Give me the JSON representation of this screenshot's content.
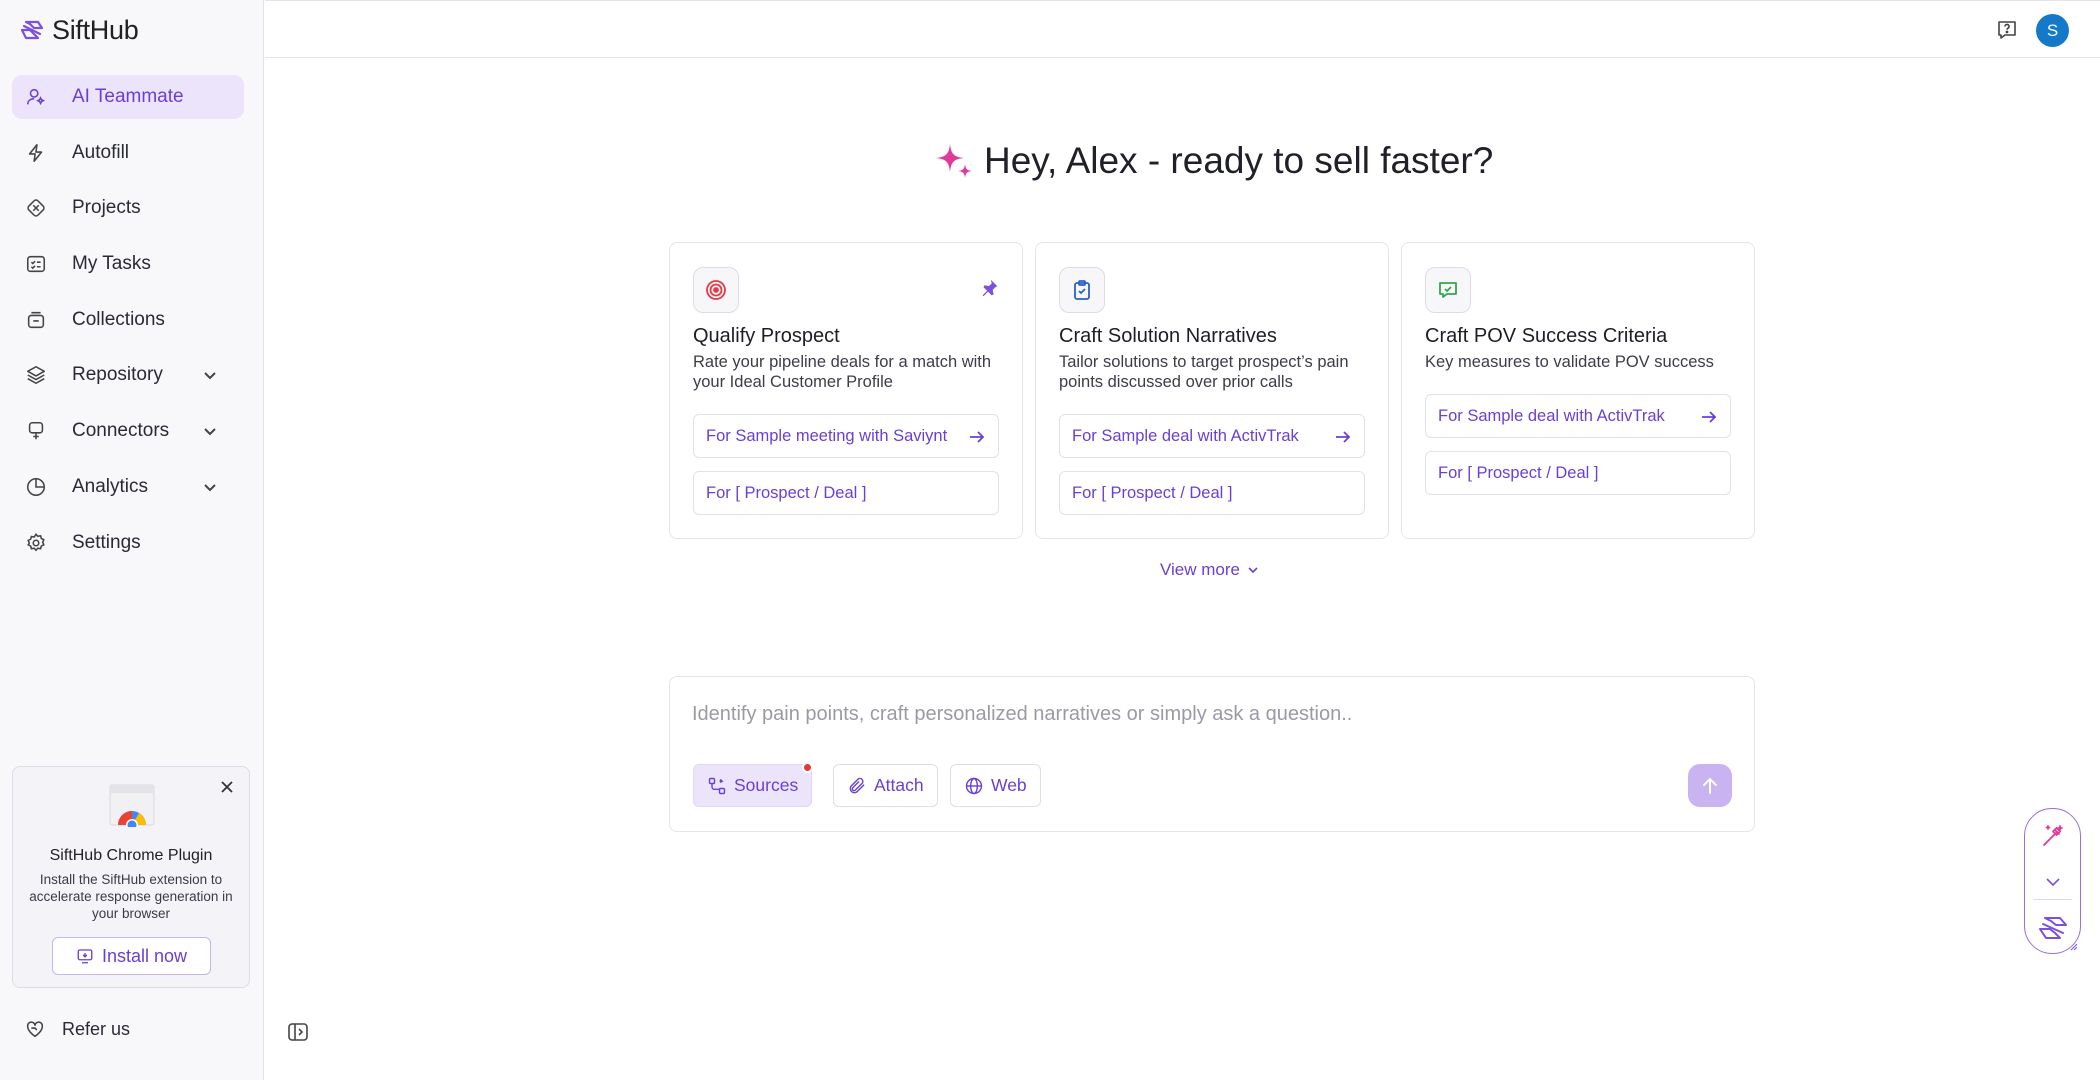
{
  "app": {
    "name": "SiftHub"
  },
  "sidebar": {
    "items": [
      {
        "label": "AI Teammate",
        "icon": "user-icon",
        "active": true
      },
      {
        "label": "Autofill",
        "icon": "lightning-icon"
      },
      {
        "label": "Projects",
        "icon": "projects-icon"
      },
      {
        "label": "My Tasks",
        "icon": "tasks-icon"
      },
      {
        "label": "Collections",
        "icon": "collections-icon"
      },
      {
        "label": "Repository",
        "icon": "layers-icon",
        "expandable": true
      },
      {
        "label": "Connectors",
        "icon": "plug-icon",
        "expandable": true
      },
      {
        "label": "Analytics",
        "icon": "pie-chart-icon",
        "expandable": true
      },
      {
        "label": "Settings",
        "icon": "gear-icon"
      }
    ],
    "plugin": {
      "title": "SiftHub Chrome Plugin",
      "description": "Install the SiftHub extension to accelerate response generation in your browser",
      "button": "Install now"
    },
    "refer": "Refer us"
  },
  "topbar": {
    "avatar_initial": "S"
  },
  "main": {
    "greeting": "Hey, Alex - ready to sell faster?",
    "cards": [
      {
        "title": "Qualify Prospect",
        "description": "Rate your pipeline deals for a match with your Ideal Customer Profile",
        "actions": [
          "For Sample meeting with Saviynt",
          "For [ Prospect / Deal ]"
        ],
        "icon": "target-icon",
        "pinned": true
      },
      {
        "title": "Craft Solution Narratives",
        "description": "Tailor solutions to target prospect’s pain points discussed over prior calls",
        "actions": [
          "For Sample deal with ActivTrak",
          "For [ Prospect / Deal ]"
        ],
        "icon": "clipboard-check-icon"
      },
      {
        "title": "Craft POV Success Criteria",
        "description": "Key measures to validate POV success",
        "actions": [
          "For Sample deal with ActivTrak",
          "For [ Prospect / Deal ]"
        ],
        "icon": "chat-check-icon"
      }
    ],
    "view_more": "View more",
    "composer": {
      "placeholder": "Identify pain points, craft personalized narratives or simply ask a question..",
      "chips": [
        "Sources",
        "Attach",
        "Web"
      ]
    }
  },
  "colors": {
    "accent": "#6b3fd4",
    "active_bg": "#ebe4fb",
    "avatar": "#1479c9",
    "sparkle": "#e0399b"
  }
}
